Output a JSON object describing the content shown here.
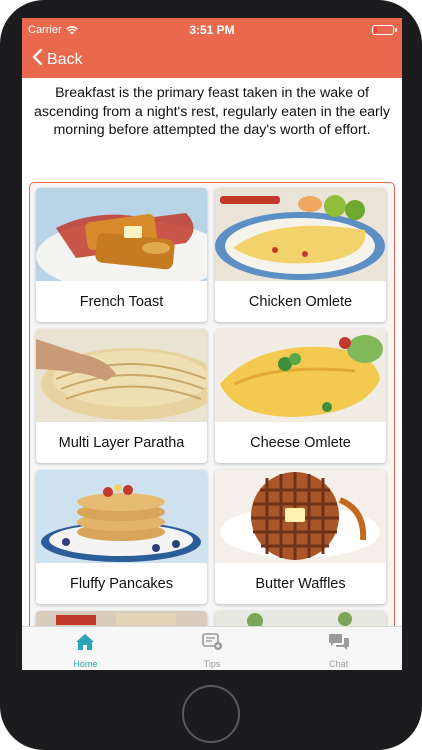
{
  "status": {
    "carrier": "Carrier",
    "time": "3:51 PM"
  },
  "nav": {
    "back_label": "Back"
  },
  "intro": "Breakfast is the primary feast taken in the wake of ascending from a night's rest, regularly eaten in the early morning before attempted the day's worth of effort.",
  "items": [
    {
      "label": "French Toast"
    },
    {
      "label": "Chicken Omlete"
    },
    {
      "label": "Multi Layer Paratha"
    },
    {
      "label": "Cheese Omlete"
    },
    {
      "label": "Fluffy Pancakes"
    },
    {
      "label": "Butter Waffles"
    }
  ],
  "tabs": [
    {
      "label": "Home",
      "icon": "home-icon"
    },
    {
      "label": "Tips",
      "icon": "tips-icon"
    },
    {
      "label": "Chat",
      "icon": "chat-icon"
    }
  ],
  "colors": {
    "accent": "#e8694d",
    "tab_active": "#2aa4b8",
    "tab_inactive": "#9a9a9a"
  }
}
